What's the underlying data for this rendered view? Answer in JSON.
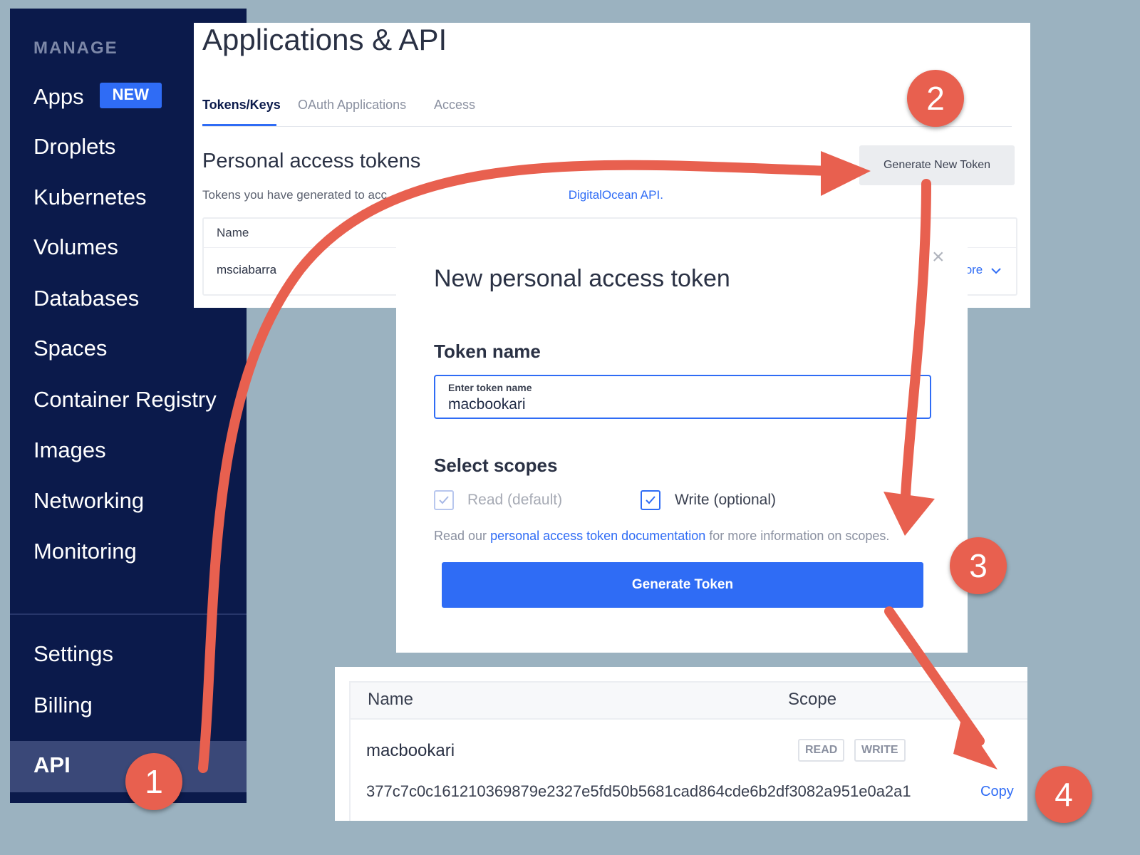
{
  "sidebar": {
    "section_title": "MANAGE",
    "items": [
      {
        "label": "Apps",
        "badge": "NEW"
      },
      {
        "label": "Droplets"
      },
      {
        "label": "Kubernetes"
      },
      {
        "label": "Volumes"
      },
      {
        "label": "Databases"
      },
      {
        "label": "Spaces"
      },
      {
        "label": "Container Registry"
      },
      {
        "label": "Images"
      },
      {
        "label": "Networking"
      },
      {
        "label": "Monitoring"
      }
    ],
    "bottom_items": [
      {
        "label": "Settings"
      },
      {
        "label": "Billing"
      }
    ],
    "active_item": {
      "label": "API"
    }
  },
  "page": {
    "title": "Applications & API",
    "tabs": [
      {
        "label": "Tokens/Keys",
        "active": true
      },
      {
        "label": "OAuth Applications",
        "active": false
      },
      {
        "label": "Access",
        "active": false
      }
    ],
    "section_heading": "Personal access tokens",
    "section_desc_prefix": "Tokens you have generated to acc",
    "section_desc_link": "DigitalOcean API.",
    "generate_new_label": "Generate New Token",
    "tokens_table": {
      "header_name": "Name",
      "rows": [
        {
          "name": "msciabarra",
          "more_label": "ore"
        }
      ]
    }
  },
  "modal": {
    "title": "New personal access token",
    "token_name_label": "Token name",
    "input_floating_label": "Enter token name",
    "input_value": "macbookari",
    "scopes_label": "Select scopes",
    "scopes": [
      {
        "label": "Read (default)",
        "checked": true,
        "disabled": true
      },
      {
        "label": "Write (optional)",
        "checked": true,
        "disabled": false
      }
    ],
    "help_prefix": "Read our",
    "help_link": "personal access token documentation",
    "help_suffix": "for more information on scopes.",
    "generate_button": "Generate Token",
    "close_glyph": "×"
  },
  "result": {
    "header_name": "Name",
    "header_scope": "Scope",
    "token_name": "macbookari",
    "scope_tags": [
      "READ",
      "WRITE"
    ],
    "token_value": "377c7c0c161210369879e2327e5fd50b5681cad864cde6b2df3082a951e0a2a1",
    "copy_label": "Copy"
  },
  "annotations": {
    "steps": [
      "1",
      "2",
      "3",
      "4"
    ],
    "arrow_color": "#e8604f"
  },
  "colors": {
    "background": "#9bb2c0",
    "sidebar": "#0b1a4b",
    "accent": "#2f6cf5"
  }
}
